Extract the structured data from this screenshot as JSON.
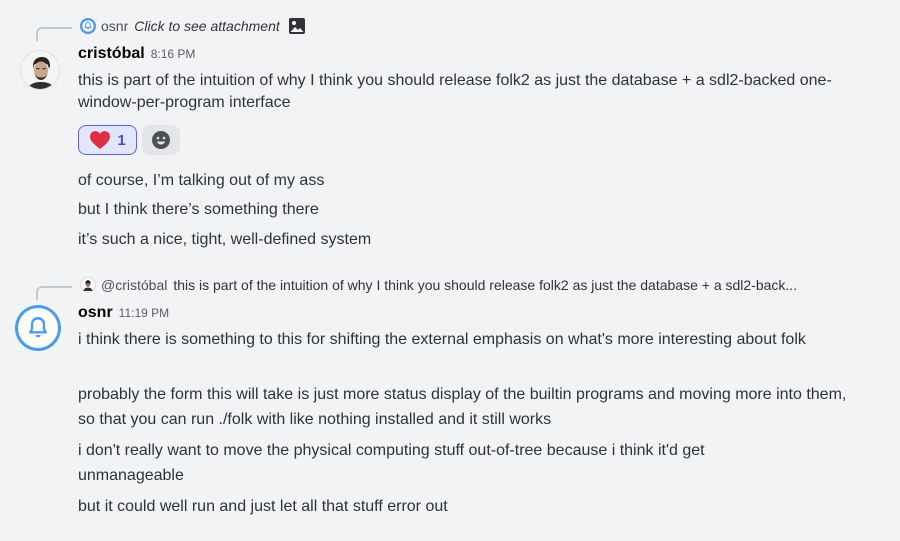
{
  "reply1": {
    "author": "osnr",
    "text": "Click to see attachment"
  },
  "message1": {
    "author": "cristóbal",
    "time": "8:16 PM",
    "lines": [
      "this is part of the intuition of why I think you should release folk2 as just the database + a sdl2-backed one-window-per-program interface"
    ],
    "reaction": {
      "emoji": "heart",
      "count": "1"
    },
    "followups": [
      "of course, I’m talking out of my ass",
      "but I think there’s something there",
      "it’s such a nice, tight, well-defined system"
    ]
  },
  "reply2": {
    "author": "@cristóbal",
    "text": "this is part of the intuition of why I think you should release folk2 as just the database + a sdl2-back..."
  },
  "message2": {
    "author": "osnr",
    "time": "11:19 PM",
    "lines": [
      "i think there is something to this for shifting the external emphasis on what's more interesting about folk",
      "probably the form this will take is just more status display of the builtin programs and moving more into them, so that you can run ./folk with like nothing installed and it still works",
      "i don't really want to move the physical computing stuff out-of-tree because i think it'd get unmanageable",
      "but it could well run and just let all that stuff error out"
    ]
  },
  "colors": {
    "background": "#f2f3f5",
    "heart": "#dd2e44",
    "reaction_active_border": "#5865f2",
    "bell_avatar": "#4c9be8"
  }
}
